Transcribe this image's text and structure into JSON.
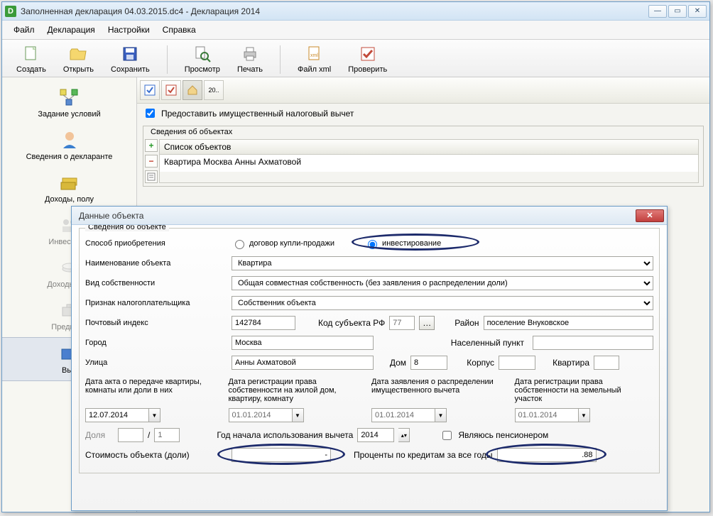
{
  "main_window": {
    "title": "Заполненная декларация 04.03.2015.dc4 - Декларация 2014",
    "menu": {
      "file": "Файл",
      "decl": "Декларация",
      "settings": "Настройки",
      "help": "Справка"
    },
    "toolbar": {
      "create": "Создать",
      "open": "Открыть",
      "save": "Сохранить",
      "preview": "Просмотр",
      "print": "Печать",
      "xml": "Файл xml",
      "check": "Проверить"
    },
    "sidebar": {
      "conditions": "Задание условий",
      "declarant": "Сведения о декларанте",
      "income": "Доходы, полу",
      "invest": "Инвест. тов",
      "income_abroad": "Доходы за п",
      "entrepreneur": "Предприн",
      "deductions": "Выч"
    },
    "content": {
      "mini_20": "20..",
      "deduction_checkbox": "Предоставить имущественный налоговый вычет",
      "objects_group": "Сведения об объектах",
      "list_header": "Список объектов",
      "list_row": "Квартира Москва  Анны Ахматовой"
    }
  },
  "dialog": {
    "title": "Данные объекта",
    "group1": "Сведения об объекте",
    "acq_label": "Способ приобретения",
    "acq_opt1": "договор купли-продажи",
    "acq_opt2": "инвестирование",
    "name_label": "Наименование объекта",
    "name_value": "Квартира",
    "ownership_label": "Вид собственности",
    "ownership_value": "Общая совместная собственность (без заявления о распределении доли)",
    "sign_label": "Признак налогоплательщика",
    "sign_value": "Собственник объекта",
    "post_label": "Почтовый индекс",
    "post_value": "142784",
    "region_code_label": "Код субъекта РФ",
    "region_code_value": "77",
    "region_label": "Район",
    "region_value": "поселение Внуковское",
    "city_label": "Город",
    "city_value": "Москва",
    "locality_label": "Населенный пункт",
    "locality_value": "",
    "street_label": "Улица",
    "street_value": "Анны Ахматовой",
    "house_label": "Дом",
    "house_value": "8",
    "block_label": "Корпус",
    "block_value": "",
    "flat_label": "Квартира",
    "flat_value": "",
    "date_col1": "Дата акта о передаче квартиры, комнаты или доли в них",
    "date_col2": "Дата регистрации права собственности на жилой дом, квартиру, комнату",
    "date_col3": "Дата заявления о распределении имущественного вычета",
    "date_col4": "Дата регистрации права собственности на земельный участок",
    "date1": "12.07.2014",
    "date2": "01.01.2014",
    "date3": "01.01.2014",
    "date4": "01.01.2014",
    "share_label": "Доля",
    "share_sep": "/",
    "share_a": "",
    "share_b": "1",
    "year_label": "Год начала использования вычета",
    "year_value": "2014",
    "pensioner_label": "Являюсь пенсионером",
    "cost_label": "Стоимость объекта (доли)",
    "cost_value": "-",
    "interest_label": "Проценты по кредитам за все годы",
    "interest_value": ".88"
  }
}
